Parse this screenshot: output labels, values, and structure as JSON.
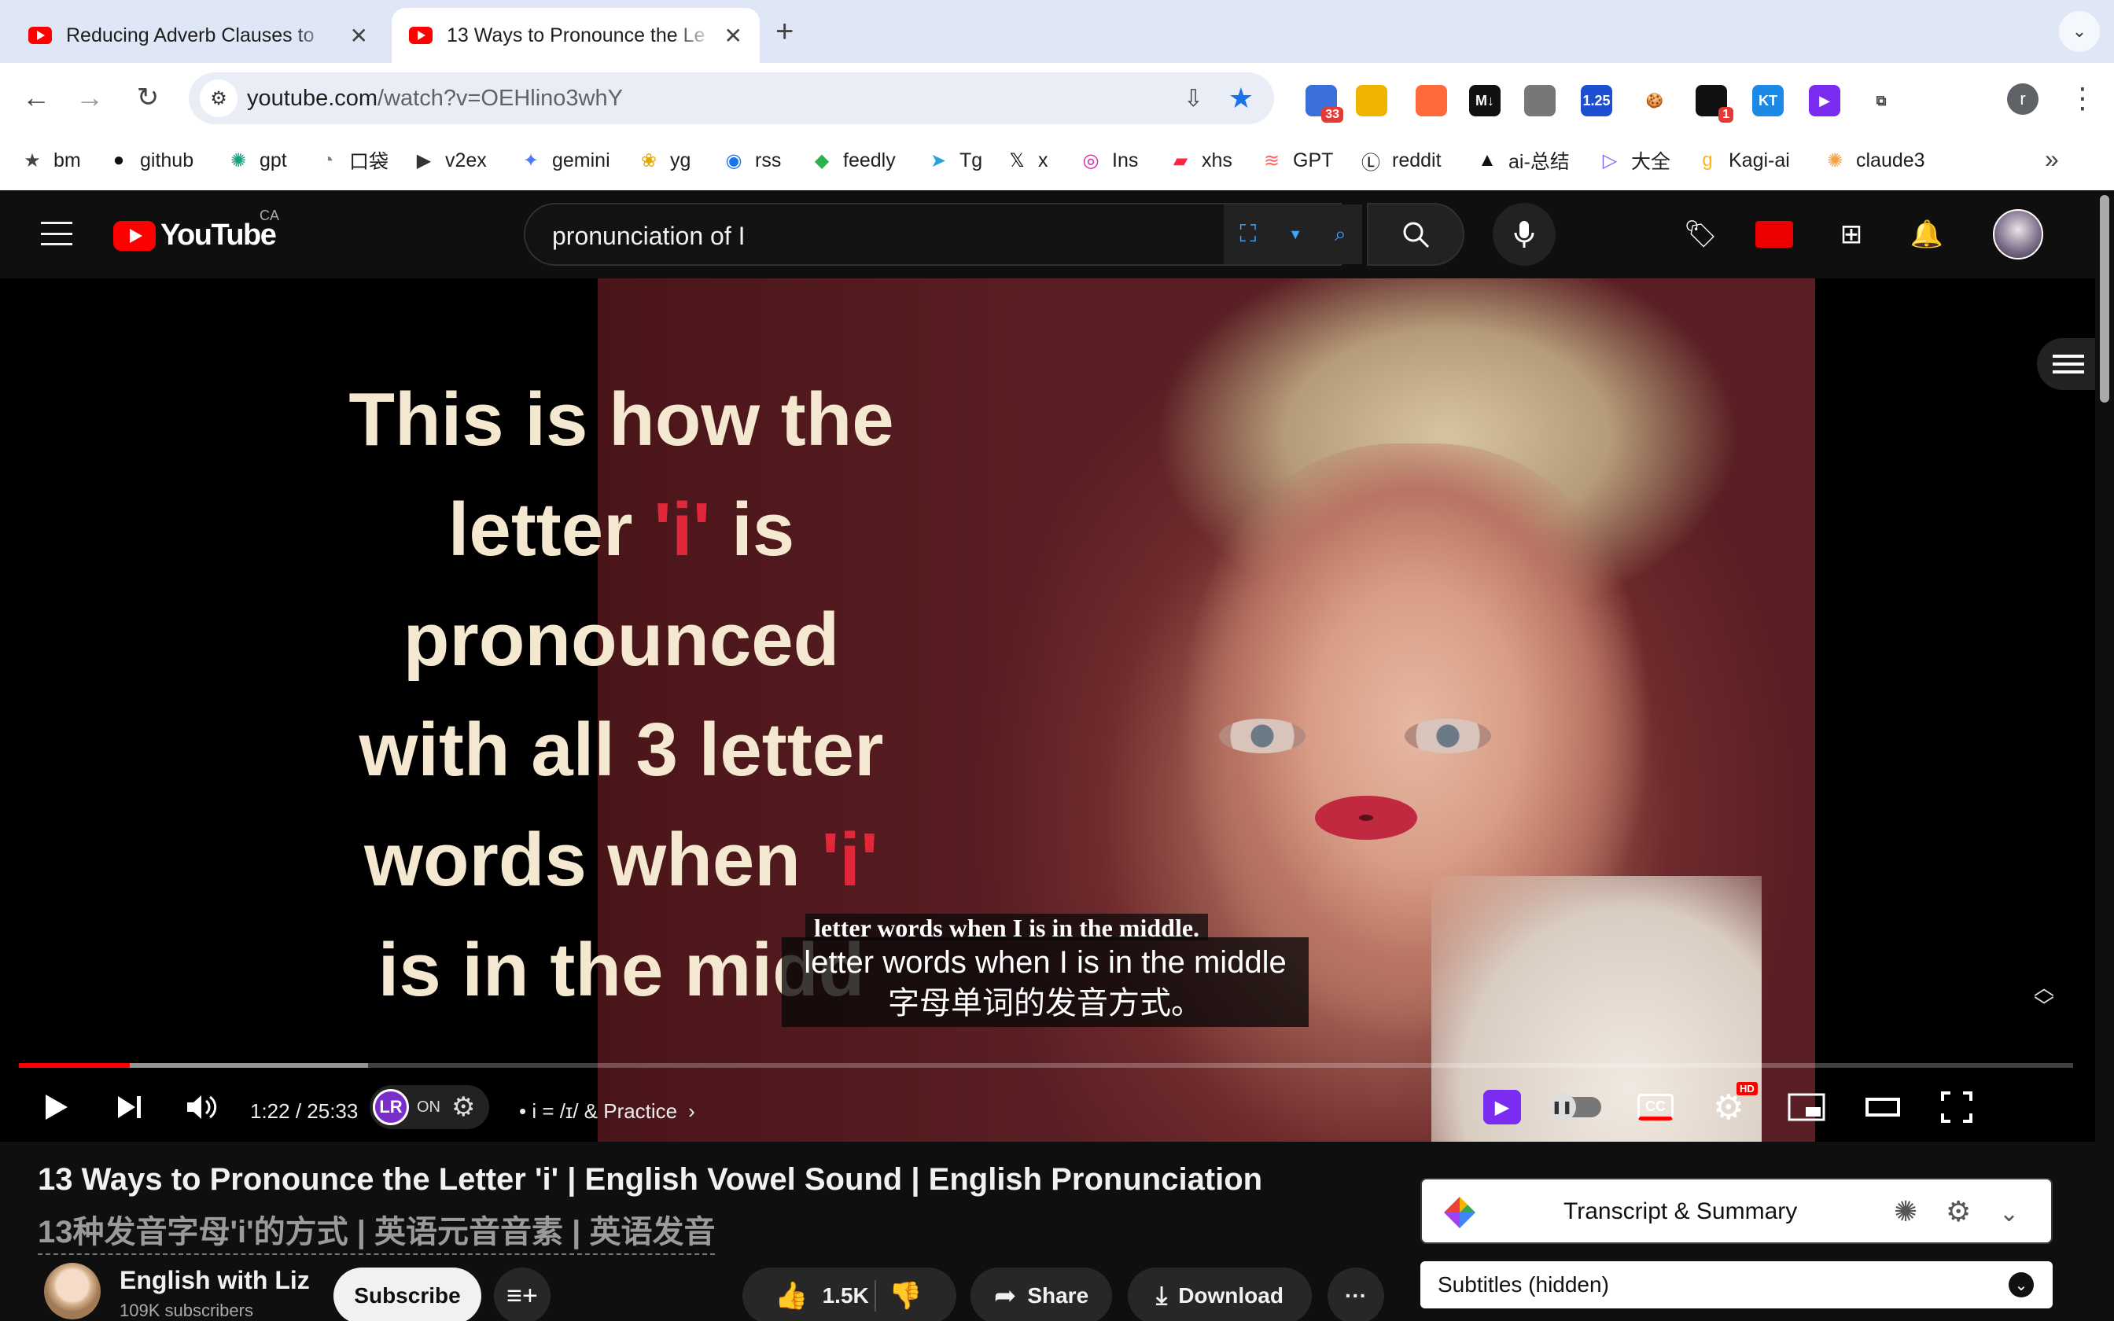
{
  "browser": {
    "tabs": [
      {
        "title": "Reducing Adverb Clauses to",
        "favicon": "youtube-icon",
        "active": false
      },
      {
        "title": "13 Ways to Pronounce the Le",
        "favicon": "youtube-icon",
        "active": true
      }
    ],
    "new_tab_label": "+",
    "url_host": "youtube.com",
    "url_path": "/watch?v=OEHlino3whY",
    "extensions": [
      {
        "name": "calendar-ext",
        "badge": "33",
        "color": "#3b6fd9"
      },
      {
        "name": "colorful-ext",
        "badge": "",
        "color": "#f0b400"
      },
      {
        "name": "bubbles-ext",
        "badge": "",
        "color": "#ff6a3d"
      },
      {
        "name": "markdown-ext",
        "label": "M↓",
        "color": "#111111"
      },
      {
        "name": "download-ext",
        "badge": "",
        "color": "#777777"
      },
      {
        "name": "speed-ext",
        "label": "1.25",
        "color": "#1f4fd1"
      },
      {
        "name": "cookie-ext",
        "label": "🍪",
        "color": "#ffffff"
      },
      {
        "name": "notify-ext",
        "badge": "1",
        "color": "#111111"
      },
      {
        "name": "kt-ext",
        "label": "KT",
        "color": "#1e88e5"
      },
      {
        "name": "play-ext",
        "label": "▶",
        "color": "#7a2cf0"
      },
      {
        "name": "puzzle-ext",
        "label": "⧉",
        "color": "#ffffff"
      }
    ],
    "profile_letter": "r"
  },
  "bookmarks": [
    {
      "label": "bm",
      "icon": "star-icon",
      "glyph": "★",
      "color": "#444444"
    },
    {
      "label": "github",
      "icon": "github-icon",
      "glyph": "●",
      "color": "#111111"
    },
    {
      "label": "gpt",
      "icon": "openai-icon",
      "glyph": "✺",
      "color": "#10a37f"
    },
    {
      "label": "口袋",
      "icon": "pocket-icon",
      "glyph": "◔",
      "color": "#7a7a7a"
    },
    {
      "label": "v2ex",
      "icon": "v2ex-icon",
      "glyph": "▶",
      "color": "#333333"
    },
    {
      "label": "gemini",
      "icon": "gemini-icon",
      "glyph": "✦",
      "color": "#4b7bf5"
    },
    {
      "label": "yg",
      "icon": "yg-icon",
      "glyph": "❀",
      "color": "#e4a800"
    },
    {
      "label": "rss",
      "icon": "rss-icon",
      "glyph": "◉",
      "color": "#1a73e8"
    },
    {
      "label": "feedly",
      "icon": "feedly-icon",
      "glyph": "◆",
      "color": "#2bb24c"
    },
    {
      "label": "Tg",
      "icon": "telegram-icon",
      "glyph": "➤",
      "color": "#2aa1da"
    },
    {
      "label": "x",
      "icon": "x-icon",
      "glyph": "𝕏",
      "color": "#000000"
    },
    {
      "label": "Ins",
      "icon": "instagram-icon",
      "glyph": "◎",
      "color": "#d6249f"
    },
    {
      "label": "xhs",
      "icon": "xhs-icon",
      "glyph": "▰",
      "color": "#ff2442"
    },
    {
      "label": "GPT",
      "icon": "gpt-stripes-icon",
      "glyph": "≋",
      "color": "#ff5f5f"
    },
    {
      "label": "reddit",
      "icon": "reddit-l-icon",
      "glyph": "Ⓛ",
      "color": "#111111"
    },
    {
      "label": "ai-总结",
      "icon": "triangle-icon",
      "glyph": "▲",
      "color": "#111111"
    },
    {
      "label": "大全",
      "icon": "play-outline-icon",
      "glyph": "▷",
      "color": "#7b5cff"
    },
    {
      "label": "Kagi-ai",
      "icon": "kagi-icon",
      "glyph": "g",
      "color": "#ffb319"
    },
    {
      "label": "claude3",
      "icon": "claude-icon",
      "glyph": "✺",
      "color": "#f4a340"
    }
  ],
  "youtube": {
    "logo_text": "YouTube",
    "country": "CA",
    "search_query": "pronunciation of I"
  },
  "video": {
    "overlay_lines": [
      {
        "pre": "This is how the",
        "red": "",
        "post": ""
      },
      {
        "pre": "letter ",
        "red": "'i'",
        "post": " is"
      },
      {
        "pre": "pronounced",
        "red": "",
        "post": ""
      },
      {
        "pre": "with all 3 letter",
        "red": "",
        "post": ""
      },
      {
        "pre": "words when ",
        "red": "'i'",
        "post": ""
      },
      {
        "pre": "is in the midd",
        "red": "",
        "post": ""
      }
    ],
    "caption_serif": "letter words when I is in the middle.",
    "caption_en": "letter words when I is in the middle",
    "caption_zh": "字母单词的发音方式。",
    "time": "1:22 / 25:33",
    "progress": {
      "played_fraction": 0.054,
      "loaded_fraction": 0.17
    },
    "lr_label": "LR",
    "lr_state": "ON",
    "chapter": "• i = /ɪ/ & Practice",
    "hd_badge": "HD"
  },
  "details": {
    "title": "13 Ways to Pronounce the Letter 'i' | English Vowel Sound | English Pronunciation",
    "title_zh": "13种发音字母'i'的方式 | 英语元音音素 | 英语发音",
    "channel_name": "English with Liz",
    "subscribers": "109K subscribers",
    "subscribe_label": "Subscribe",
    "likes": "1.5K",
    "share_label": "Share",
    "download_label": "Download",
    "more_label": "···"
  },
  "sidebar": {
    "transcript_label": "Transcript & Summary",
    "subtitles_label": "Subtitles (hidden)"
  }
}
